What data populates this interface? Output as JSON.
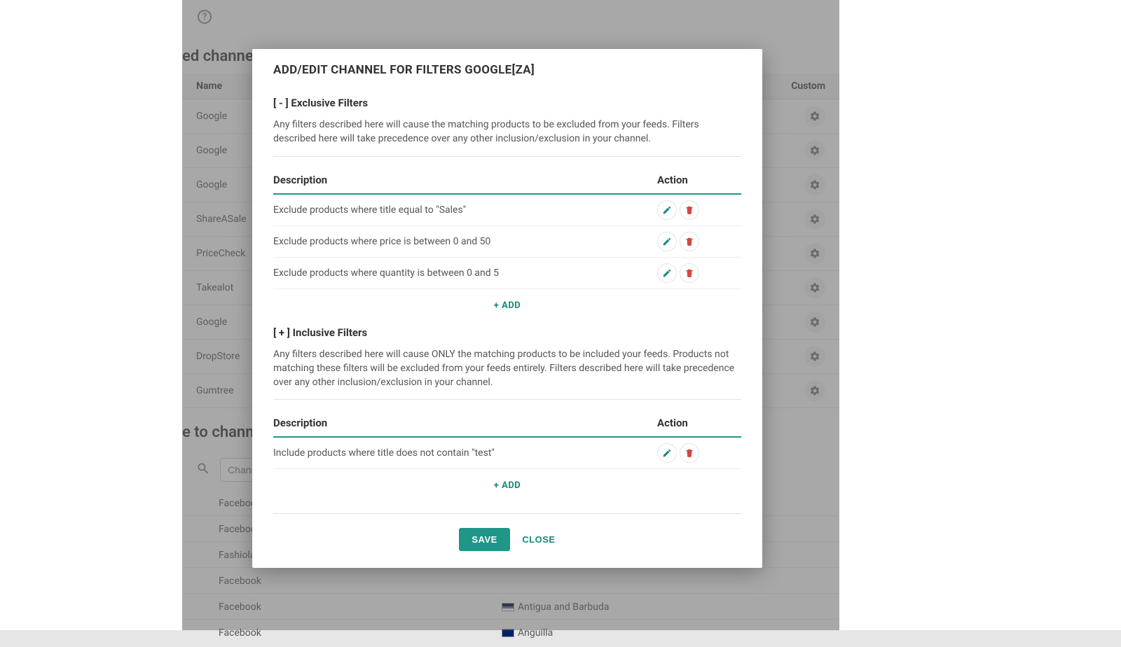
{
  "background": {
    "section1_title": "ed channels:",
    "section2_title": "e to channel",
    "table1": {
      "col_name": "Name",
      "col_custom": "Custom",
      "rows": [
        "Google",
        "Google",
        "Google",
        "ShareASale",
        "PriceCheck",
        "Takealot",
        "Google",
        "DropStore",
        "Gumtree"
      ]
    },
    "search_placeholder": "Channel",
    "list2": [
      {
        "name": "Facebook",
        "country": ""
      },
      {
        "name": "Facebook",
        "country": ""
      },
      {
        "name": "Fashiola",
        "country": ""
      },
      {
        "name": "Facebook",
        "country": ""
      },
      {
        "name": "Facebook",
        "country": "Antigua and Barbuda",
        "flag": "ag"
      },
      {
        "name": "Facebook",
        "country": "Anguilla",
        "flag": "ai"
      }
    ]
  },
  "modal": {
    "title": "ADD/EDIT CHANNEL FOR FILTERS GOOGLE[ZA]",
    "exclusive": {
      "heading": "[ - ] Exclusive Filters",
      "description": "Any filters described here will cause the matching products to be excluded from your feeds. Filters described here will take precedence over any other inclusion/exclusion in your channel.",
      "col_desc": "Description",
      "col_action": "Action",
      "rows": [
        "Exclude products where title equal to \"Sales\"",
        "Exclude products where price is between 0 and 50",
        "Exclude products where quantity is between 0 and 5"
      ],
      "add_label": "+ ADD"
    },
    "inclusive": {
      "heading": "[ + ] Inclusive Filters",
      "description": "Any filters described here will cause ONLY the matching products to be included your feeds. Products not matching these filters will be excluded from your feeds entirely. Filters described here will take precedence over any other inclusion/exclusion in your channel.",
      "col_desc": "Description",
      "col_action": "Action",
      "rows": [
        "Include products where title does not contain \"test\""
      ],
      "add_label": "+ ADD"
    },
    "save_label": "SAVE",
    "close_label": "CLOSE"
  }
}
